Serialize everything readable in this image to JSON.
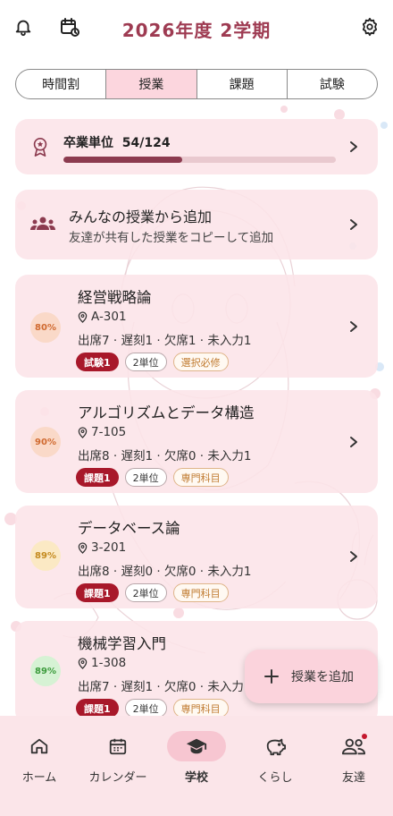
{
  "header": {
    "title": "2026年度 2学期",
    "icons": [
      "bell-icon",
      "calendar-history-icon",
      "gear-icon"
    ]
  },
  "tabs": [
    {
      "label": "時間割",
      "active": false
    },
    {
      "label": "授業",
      "active": true
    },
    {
      "label": "課題",
      "active": false
    },
    {
      "label": "試験",
      "active": false
    }
  ],
  "credits": {
    "label": "卒業単位",
    "value": "54/124",
    "progress": 0.435
  },
  "add_from_others": {
    "title": "みんなの授業から追加",
    "subtitle": "友達が共有した授業をコピーして追加"
  },
  "courses": [
    {
      "name": "経営戦略論",
      "room": "A-301",
      "attendance": "出席7 · 遅刻1 · 欠席1 · 未入力1",
      "rate": "80%",
      "rate_color": "orange",
      "tags": [
        {
          "text": "試験1",
          "style": "red"
        },
        {
          "text": "2単位",
          "style": "plain"
        },
        {
          "text": "選択必修",
          "style": "orange"
        }
      ]
    },
    {
      "name": "アルゴリズムとデータ構造",
      "room": "7-105",
      "attendance": "出席8 · 遅刻1 · 欠席0 · 未入力1",
      "rate": "90%",
      "rate_color": "orange",
      "tags": [
        {
          "text": "課題1",
          "style": "red"
        },
        {
          "text": "2単位",
          "style": "plain"
        },
        {
          "text": "専門科目",
          "style": "orange"
        }
      ]
    },
    {
      "name": "データベース論",
      "room": "3-201",
      "attendance": "出席8 · 遅刻0 · 欠席0 · 未入力1",
      "rate": "89%",
      "rate_color": "yellow",
      "tags": [
        {
          "text": "課題1",
          "style": "red"
        },
        {
          "text": "2単位",
          "style": "plain"
        },
        {
          "text": "専門科目",
          "style": "orange"
        }
      ]
    },
    {
      "name": "機械学習入門",
      "room": "1-308",
      "attendance": "出席7 · 遅刻1 · 欠席0 · 未入力1",
      "rate": "89%",
      "rate_color": "green",
      "tags": [
        {
          "text": "課題1",
          "style": "red"
        },
        {
          "text": "2単位",
          "style": "plain"
        },
        {
          "text": "専門科目",
          "style": "orange"
        }
      ]
    }
  ],
  "fab": {
    "label": "授業を追加"
  },
  "bottom_nav": [
    {
      "label": "ホーム",
      "icon": "home-icon",
      "active": false,
      "badge": false
    },
    {
      "label": "カレンダー",
      "icon": "calendar-icon",
      "active": false,
      "badge": false
    },
    {
      "label": "学校",
      "icon": "graduation-cap-icon",
      "active": true,
      "badge": false
    },
    {
      "label": "くらし",
      "icon": "piggy-bank-icon",
      "active": false,
      "badge": false
    },
    {
      "label": "友達",
      "icon": "friends-icon",
      "active": false,
      "badge": true
    }
  ],
  "colors": {
    "accent": "#9e3b52",
    "card_bg": "#fce4e8",
    "nav_bg": "#fbe5e9",
    "progress": "#8c3b4f",
    "tag_red": "#a8182a"
  }
}
